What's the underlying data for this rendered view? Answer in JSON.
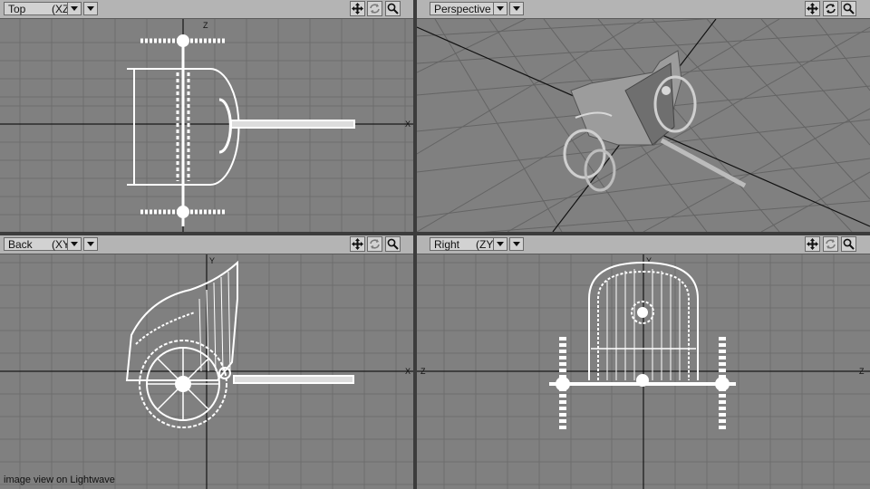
{
  "viewports": [
    {
      "id": "top",
      "view": "Top",
      "axes": "(XZ)"
    },
    {
      "id": "perspective",
      "view": "Perspective",
      "axes": ""
    },
    {
      "id": "back",
      "view": "Back",
      "axes": "(XY)"
    },
    {
      "id": "right",
      "view": "Right",
      "axes": "(ZY)"
    }
  ],
  "axis_labels": {
    "top_h": "X",
    "top_v": "Z",
    "back_h": "X",
    "back_v": "Y",
    "right_h": "Z",
    "right_v": "Y"
  },
  "caption": "image view on Lightwave",
  "tools": {
    "move": "move-view-icon",
    "rotate": "rotate-view-icon",
    "zoom": "zoom-view-icon"
  },
  "colors": {
    "viewport_bg": "#808080",
    "grid": "#6e6e6e",
    "axis": "#000000",
    "wire": "#ffffff",
    "header": "#b4b4b4"
  }
}
